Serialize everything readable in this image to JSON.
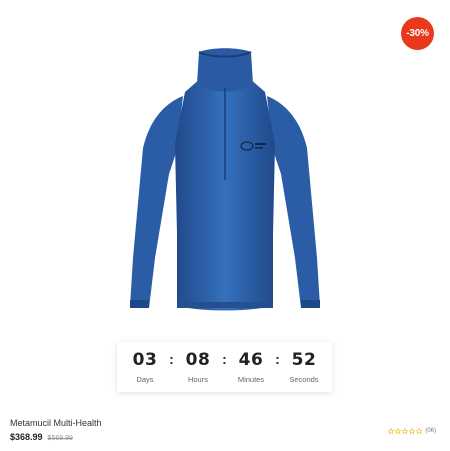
{
  "product": {
    "discount_badge": "-30%",
    "title": "Metamucil Multi-Health",
    "price": "$368.99",
    "old_price": "$569.99",
    "rating_stars": 0,
    "rating_max": 5,
    "review_count": "(06)",
    "image": "blue-half-zip-pullover-photo"
  },
  "countdown": {
    "days": {
      "value": "03",
      "label": "Days"
    },
    "hours": {
      "value": "08",
      "label": "Hours"
    },
    "minutes": {
      "value": "46",
      "label": "Minutes"
    },
    "seconds": {
      "value": "52",
      "label": "Seconds"
    },
    "separator": ":"
  },
  "colors": {
    "badge": "#e8391d",
    "garment": "#2f62ad",
    "star_empty": "#f0b400"
  }
}
